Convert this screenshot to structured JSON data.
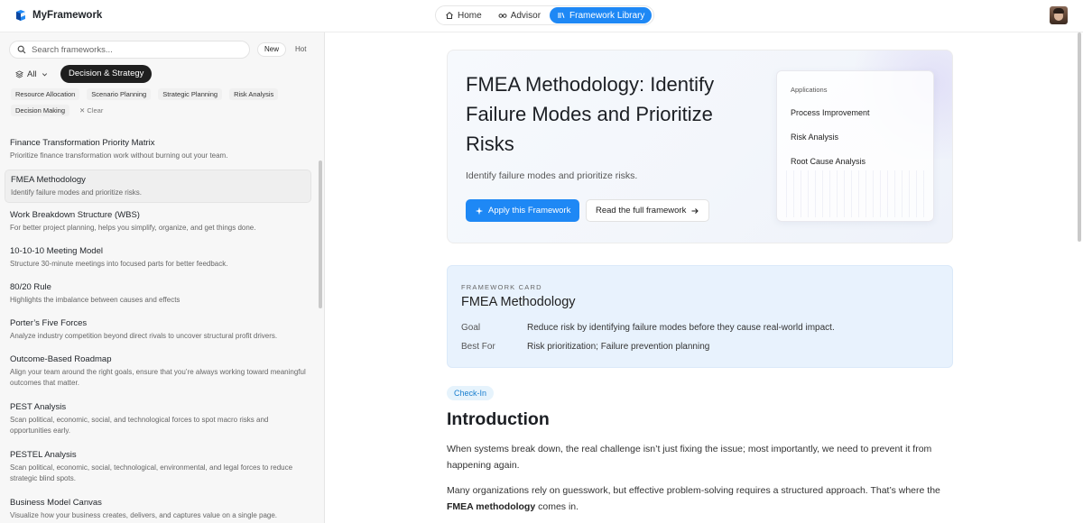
{
  "app": {
    "name": "MyFramework"
  },
  "nav": [
    {
      "label": "Home",
      "icon": "home-icon",
      "active": false
    },
    {
      "label": "Advisor",
      "icon": "glasses-icon",
      "active": false
    },
    {
      "label": "Framework Library",
      "icon": "library-icon",
      "active": true
    }
  ],
  "sidebar": {
    "search_placeholder": "Search frameworks...",
    "sort": {
      "new": "New",
      "hot": "Hot"
    },
    "all_label": "All",
    "category": "Decision & Strategy",
    "tags": [
      "Resource Allocation",
      "Scenario Planning",
      "Strategic Planning",
      "Risk Analysis",
      "Decision Making"
    ],
    "clear_label": "Clear",
    "items": [
      {
        "title": "Finance Transformation Priority Matrix",
        "desc": "Prioritize finance transformation work without burning out your team."
      },
      {
        "title": "FMEA Methodology",
        "desc": "Identify failure modes and prioritize risks."
      },
      {
        "title": "Work Breakdown Structure (WBS)",
        "desc": "For better project planning, helps you simplify, organize, and get things done."
      },
      {
        "title": "10-10-10 Meeting Model",
        "desc": "Structure 30-minute meetings into focused parts for better feedback."
      },
      {
        "title": "80/20 Rule",
        "desc": "Highlights the imbalance between causes and effects"
      },
      {
        "title": "Porter’s Five Forces",
        "desc": "Analyze industry competition beyond direct rivals to uncover structural profit drivers."
      },
      {
        "title": "Outcome-Based Roadmap",
        "desc": "Align your team around the right goals, ensure that you’re always working toward meaningful outcomes that matter."
      },
      {
        "title": "PEST Analysis",
        "desc": "Scan political, economic, social, and technological forces to spot macro risks and opportunities early."
      },
      {
        "title": "PESTEL Analysis",
        "desc": "Scan political, economic, social, technological, environmental, and legal forces to reduce strategic blind spots."
      },
      {
        "title": "Business Model Canvas",
        "desc": "Visualize how your business creates, delivers, and captures value on a single page."
      }
    ]
  },
  "hero": {
    "title": "FMEA Methodology: Identify Failure Modes and Prioritize Risks",
    "subtitle": "Identify failure modes and prioritize risks.",
    "apply_label": "Apply this Framework",
    "read_label": "Read the full framework",
    "applications_heading": "Applications",
    "applications": [
      "Process Improvement",
      "Risk Analysis",
      "Root Cause Analysis"
    ]
  },
  "card": {
    "eyebrow": "FRAMEWORK CARD",
    "title": "FMEA Methodology",
    "goal_label": "Goal",
    "goal": "Reduce risk by identifying failure modes before they cause real-world impact.",
    "best_for_label": "Best For",
    "best_for": "Risk prioritization; Failure prevention planning"
  },
  "article": {
    "badge": "Check-In",
    "heading": "Introduction",
    "p1": "When systems break down, the real challenge isn’t just fixing the issue; most importantly, we need to prevent it from happening again.",
    "p2_start": "Many organizations rely on guesswork, but effective problem-solving requires a structured approach. That’s where the ",
    "p2_bold": "FMEA methodology",
    "p2_end": " comes in."
  },
  "colors": {
    "accent": "#1e88f5",
    "chip_dark": "#1f1f1f",
    "card_bg": "#e8f2fd"
  }
}
